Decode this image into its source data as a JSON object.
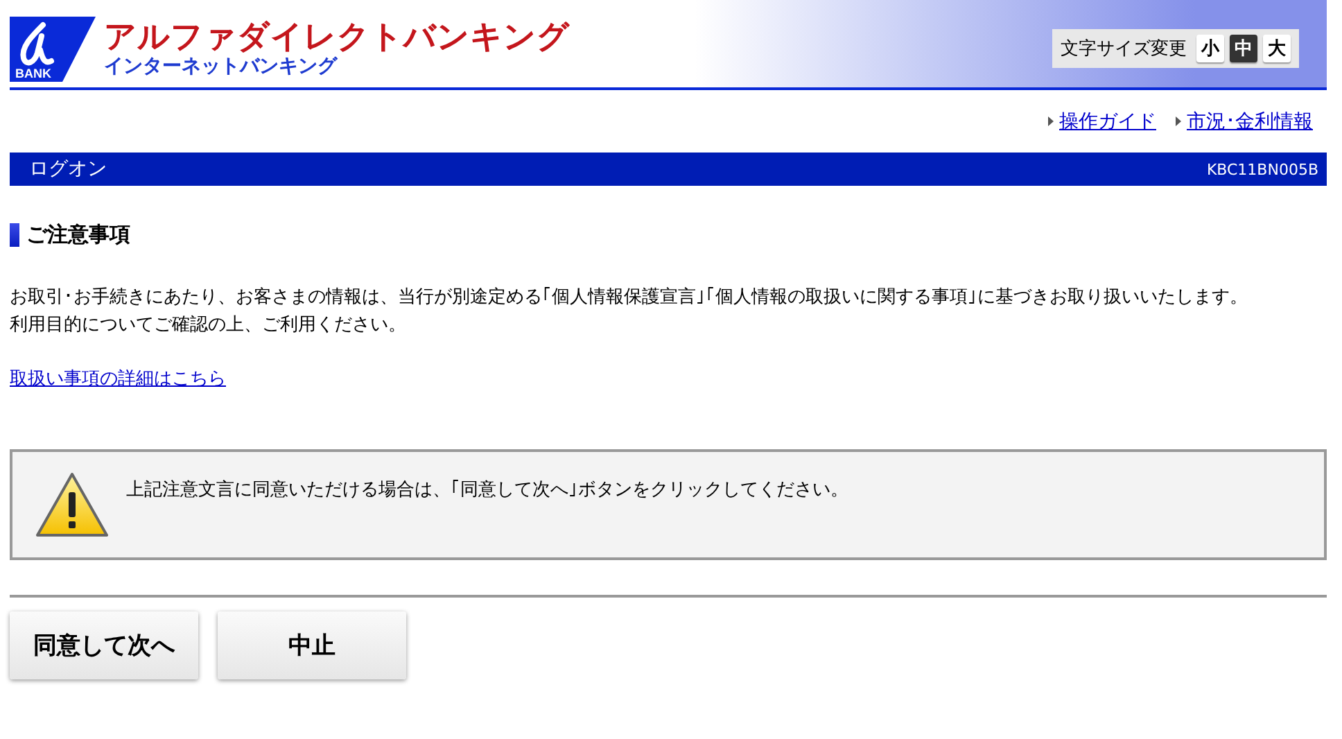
{
  "header": {
    "logo_text": "BANK",
    "title": "アルファダイレクトバンキング",
    "subtitle": "インターネットバンキング",
    "font_size": {
      "label": "文字サイズ変更",
      "options": [
        {
          "label": "小",
          "selected": false
        },
        {
          "label": "中",
          "selected": true
        },
        {
          "label": "大",
          "selected": false
        }
      ]
    }
  },
  "nav_links": [
    "操作ガイド",
    "市況･金利情報"
  ],
  "page_bar": {
    "title": "ログオン",
    "code": "KBC11BN005B"
  },
  "section": {
    "heading": "ご注意事項",
    "paragraphs": [
      "お取引･お手続きにあたり、お客さまの情報は、当行が別途定める｢個人情報保護宣言｣｢個人情報の取扱いに関する事項｣に基づきお取り扱いいたします。",
      "利用目的についてご確認の上、ご利用ください。"
    ],
    "link": "取扱い事項の詳細はこちら"
  },
  "notice": {
    "text": "上記注意文言に同意いただける場合は、｢同意して次へ｣ボタンをクリックしてください。"
  },
  "buttons": [
    "同意して次へ",
    "中止"
  ]
}
